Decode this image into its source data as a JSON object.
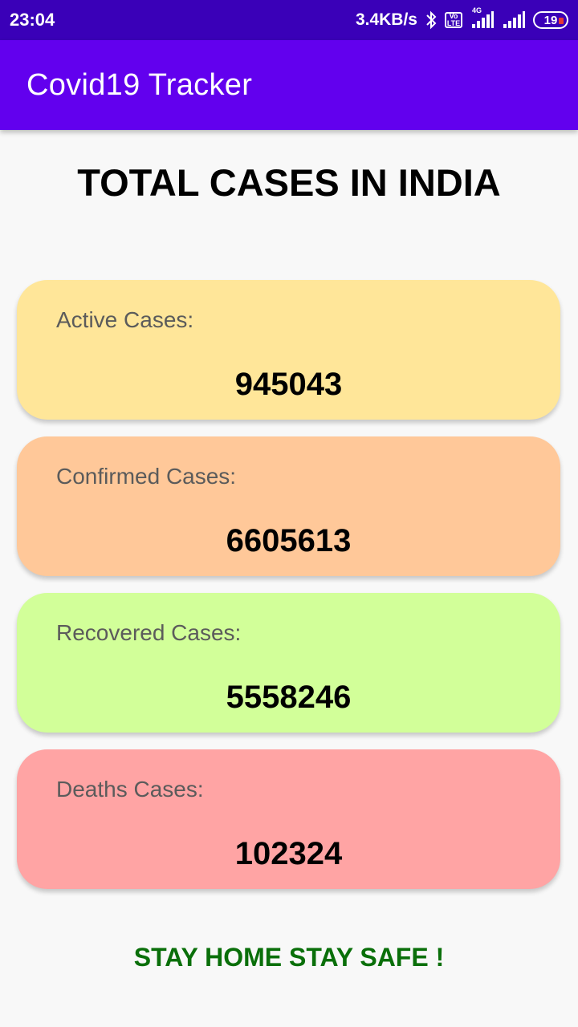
{
  "status_bar": {
    "time": "23:04",
    "net_speed": "3.4KB/s",
    "volte_top": "Vo",
    "volte_bottom": "LTE",
    "network_type": "4G",
    "battery": "19",
    "icons": [
      "bluetooth-icon",
      "volte-icon",
      "signal-icon",
      "signal-icon",
      "battery-icon"
    ]
  },
  "app_bar": {
    "title": "Covid19 Tracker"
  },
  "heading": "TOTAL CASES IN INDIA",
  "cards": [
    {
      "label": "Active Cases:",
      "value": "945043",
      "color": "#ffe699"
    },
    {
      "label": "Confirmed Cases:",
      "value": "6605613",
      "color": "#ffc899"
    },
    {
      "label": "Recovered Cases:",
      "value": "5558246",
      "color": "#d2ff99"
    },
    {
      "label": "Deaths Cases:",
      "value": "102324",
      "color": "#ffa4a4"
    }
  ],
  "footer": {
    "text": "STAY HOME STAY SAFE !",
    "color": "#0a6f0a"
  },
  "colors": {
    "status_bar": "#3a00b8",
    "app_bar": "#6200ee",
    "background": "#f8f8f8"
  }
}
